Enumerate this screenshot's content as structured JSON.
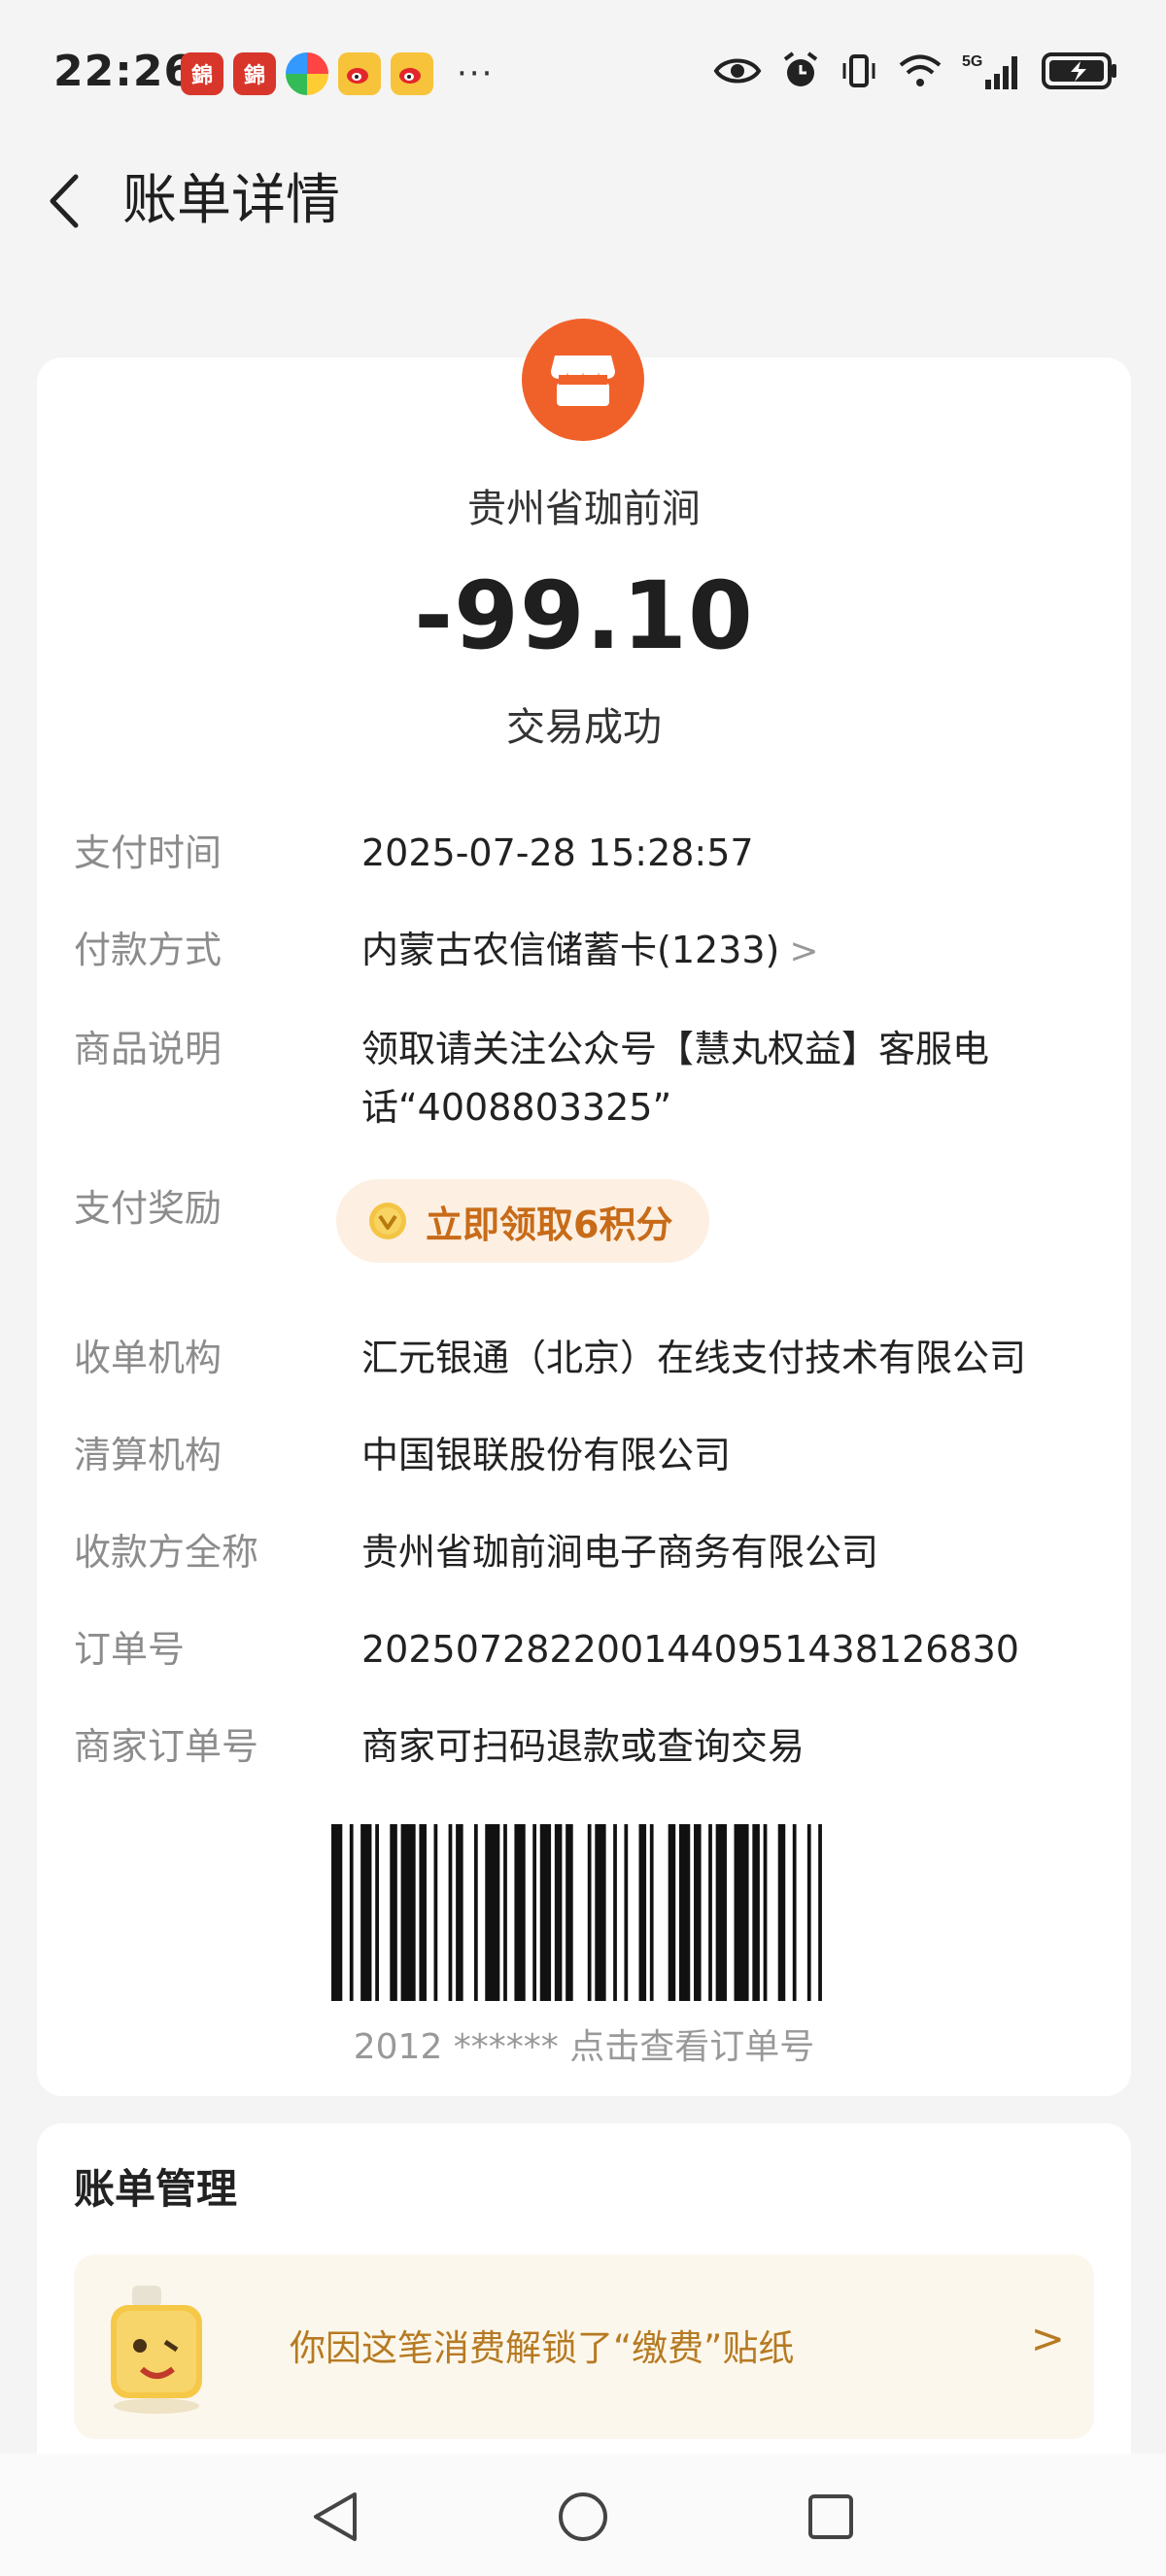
{
  "status_bar": {
    "time": "22:26",
    "app_icons": [
      "jinri-app-icon",
      "jinri-app-icon",
      "pinwheel-app-icon",
      "weibo-app-icon",
      "weibo-app-icon"
    ],
    "more": "···",
    "network": "5G"
  },
  "header": {
    "title": "账单详情"
  },
  "bill": {
    "merchant_name": "贵州省珈前涧",
    "amount": "-99.10",
    "status": "交易成功",
    "details": [
      {
        "label": "支付时间",
        "value": "2025-07-28 15:28:57"
      },
      {
        "label": "付款方式",
        "value": "内蒙古农信储蓄卡(1233)"
      },
      {
        "label": "商品说明",
        "value": "领取请关注公众号【慧丸权益】客服电话“4008803325”"
      },
      {
        "label": "支付奖励",
        "value": "立即领取6积分"
      },
      {
        "label": "收单机构",
        "value": "汇元银通（北京）在线支付技术有限公司"
      },
      {
        "label": "清算机构",
        "value": "中国银联股份有限公司"
      },
      {
        "label": "收款方全称",
        "value": "贵州省珈前涧电子商务有限公司"
      },
      {
        "label": "订单号",
        "value": "2025072822001440951438126830"
      },
      {
        "label": "商家订单号",
        "value": "商家可扫码退款或查询交易"
      }
    ],
    "barcode_caption": "2012 ****** 点击查看订单号"
  },
  "management": {
    "title": "账单管理",
    "sticker_text": "你因这笔消费解锁了“缴费”贴纸"
  },
  "colors": {
    "merchant_orange": "#f0612a",
    "reward_text": "#c86b18",
    "reward_bg": "#fdf0e2",
    "sticker_text": "#b67a22"
  }
}
